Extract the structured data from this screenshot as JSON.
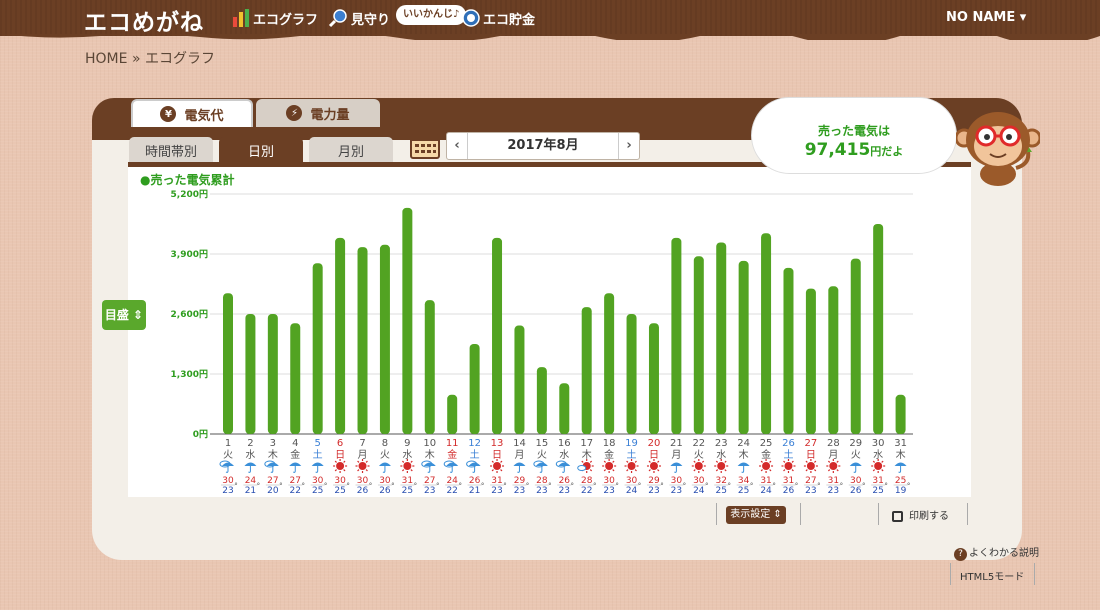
{
  "app": {
    "logo": "エコめがね",
    "user": "NO NAME ▾"
  },
  "nav": [
    {
      "label": "エコグラフ",
      "icon": "bar-chart-icon"
    },
    {
      "label": "見守り",
      "icon": "magnifier-icon"
    },
    {
      "label": "エコ貯金",
      "icon": "coin-icon"
    }
  ],
  "badge": "いいかんじ♪",
  "breadcrumb": {
    "home": "HOME",
    "sep": "»",
    "current": "エコグラフ"
  },
  "tabs": [
    {
      "label": "電気代",
      "icon": "yen-icon",
      "glyph": "¥"
    },
    {
      "label": "電力量",
      "icon": "lightning-icon",
      "glyph": "⚡"
    }
  ],
  "subtabs": [
    "時間帯別",
    "日別",
    "月別"
  ],
  "date": {
    "prev": "‹",
    "label": "2017年8月",
    "next": "›"
  },
  "sold": {
    "line1": "売った電気は",
    "value": "97,415",
    "suffix": "円だよ"
  },
  "buttons": {
    "target": "目盛 ⇕",
    "display": "表示設定 ⇕",
    "print": "印刷する",
    "help": "よくわかる説明",
    "html5": "HTML5モード"
  },
  "colors": {
    "bar": "#52a322",
    "brown": "#6b3f24",
    "saturday": "#3a7fd5",
    "sunday": "#d22b2b",
    "weekday": "#555555"
  },
  "chart_data": {
    "type": "bar",
    "title": "●売った電気累計",
    "ylim": [
      0,
      5200
    ],
    "yticks": [
      "0円",
      "1,300円",
      "2,600円",
      "3,900円",
      "5,200円"
    ],
    "ytick_values": [
      0,
      1300,
      2600,
      3900,
      5200
    ],
    "categories": [
      "1",
      "2",
      "3",
      "4",
      "5",
      "6",
      "7",
      "8",
      "9",
      "10",
      "11",
      "12",
      "13",
      "14",
      "15",
      "16",
      "17",
      "18",
      "19",
      "20",
      "21",
      "22",
      "23",
      "24",
      "25",
      "26",
      "27",
      "28",
      "29",
      "30",
      "31"
    ],
    "weekdays": [
      "火",
      "水",
      "木",
      "金",
      "土",
      "日",
      "月",
      "火",
      "水",
      "木",
      "金",
      "土",
      "日",
      "月",
      "火",
      "水",
      "木",
      "金",
      "土",
      "日",
      "月",
      "火",
      "水",
      "木",
      "金",
      "土",
      "日",
      "月",
      "火",
      "水",
      "木"
    ],
    "day_type": [
      "w",
      "w",
      "w",
      "w",
      "sat",
      "sun",
      "w",
      "w",
      "w",
      "w",
      "hol",
      "sat",
      "sun",
      "w",
      "w",
      "w",
      "w",
      "w",
      "sat",
      "sun",
      "w",
      "w",
      "w",
      "w",
      "w",
      "sat",
      "sun",
      "w",
      "w",
      "w",
      "w"
    ],
    "values": [
      3050,
      2600,
      2600,
      2400,
      3700,
      4250,
      4050,
      4100,
      4900,
      2900,
      850,
      1950,
      4250,
      2350,
      1450,
      1100,
      2750,
      3050,
      2600,
      2400,
      4250,
      3850,
      4150,
      3750,
      4350,
      3600,
      3150,
      3200,
      3800,
      4550,
      850
    ],
    "weather": [
      "cloud-rain",
      "rain",
      "cloud-rain",
      "rain",
      "rain",
      "sun",
      "sun",
      "rain",
      "sun",
      "cloud-rain",
      "cloud-rain",
      "cloud-rain",
      "sun",
      "rain",
      "cloud-rain",
      "cloud-rain",
      "sun-cloud",
      "sun",
      "sun",
      "sun",
      "rain",
      "sun",
      "sun",
      "rain",
      "sun",
      "sun",
      "sun",
      "sun",
      "rain",
      "sun",
      "rain"
    ],
    "temp_high": [
      "30",
      "24",
      "27",
      "27",
      "30",
      "30",
      "30",
      "30",
      "31",
      "27",
      "24",
      "26",
      "31",
      "29",
      "28",
      "26",
      "28",
      "30",
      "30",
      "29",
      "30",
      "30",
      "32",
      "34",
      "31",
      "31",
      "27",
      "31",
      "30",
      "31",
      "25"
    ],
    "temp_low": [
      "23",
      "21",
      "20",
      "22",
      "25",
      "25",
      "26",
      "26",
      "25",
      "23",
      "22",
      "21",
      "23",
      "23",
      "23",
      "23",
      "22",
      "23",
      "24",
      "23",
      "23",
      "24",
      "25",
      "25",
      "24",
      "26",
      "23",
      "23",
      "26",
      "25",
      "19"
    ],
    "deg": "°",
    "legend": "none",
    "grid": true
  }
}
